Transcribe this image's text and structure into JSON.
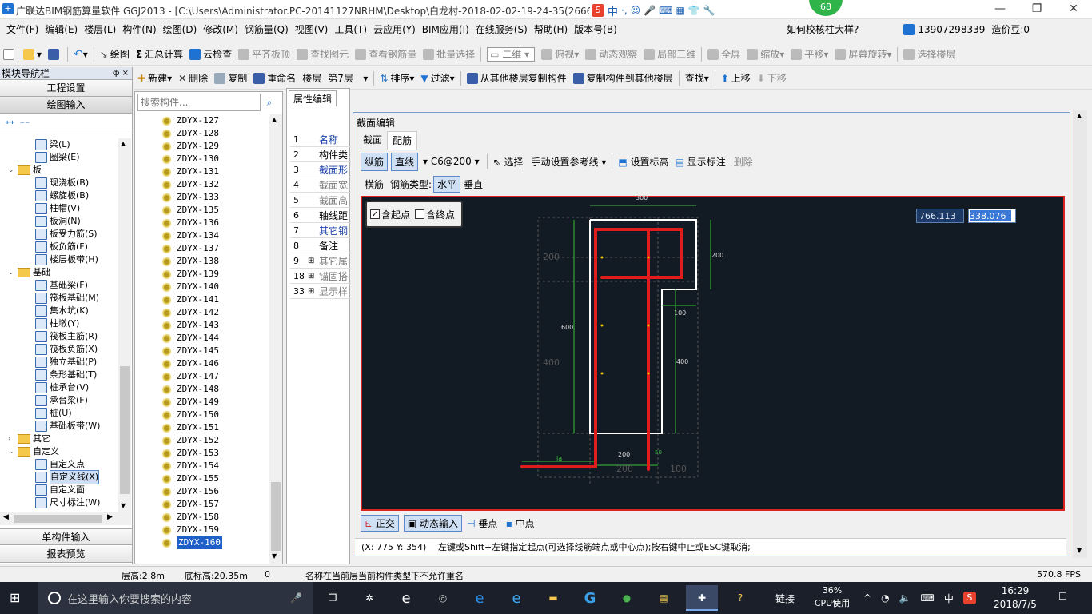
{
  "title": "广联达BIM钢筋算量软件 GGJ2013 - [C:\\Users\\Administrator.PC-20141127NRHM\\Desktop\\白龙村-2018-02-02-19-24-35(2666版).GGJ12]",
  "badge": "68",
  "menu": [
    "文件(F)",
    "编辑(E)",
    "楼层(L)",
    "构件(N)",
    "绘图(D)",
    "修改(M)",
    "钢筋量(Q)",
    "视图(V)",
    "工具(T)",
    "云应用(Y)",
    "BIM应用(I)",
    "在线服务(S)",
    "帮助(H)",
    "版本号(B)"
  ],
  "menu_right": {
    "help_q": "如何校核柱大样?",
    "user": "13907298339",
    "price": "造价豆:0"
  },
  "toolbar1": {
    "draw": "绘图",
    "sum": "汇总计算",
    "cloud": "云检查",
    "flat": "平齐板顶",
    "find": "查找图元",
    "viewq": "查看钢筋量",
    "batch": "批量选择",
    "view2d": "二维",
    "top": "俯视",
    "dyn": "动态观察",
    "local3d": "局部三维",
    "full": "全屏",
    "zoom": "缩放",
    "pan": "平移",
    "rotate": "屏幕旋转",
    "selfloor": "选择楼层"
  },
  "toolbar2": {
    "new": "新建",
    "del": "删除",
    "copy": "复制",
    "rename": "重命名",
    "floor": "楼层",
    "floorval": "第7层",
    "sort": "排序",
    "filter": "过滤",
    "copyfrom": "从其他楼层复制构件",
    "copyto": "复制构件到其他楼层",
    "find": "查找",
    "up": "上移",
    "down": "下移"
  },
  "nav": {
    "header": "模块导航栏",
    "pin": "ф ×",
    "proj": "工程设置",
    "draw": "绘图输入",
    "single": "单构件输入",
    "report": "报表预览"
  },
  "tree": [
    {
      "t": "梁(L)",
      "lvl": 2
    },
    {
      "t": "圈梁(E)",
      "lvl": 2
    },
    {
      "t": "板",
      "lvl": 0,
      "folder": true,
      "exp": "⌄"
    },
    {
      "t": "现浇板(B)",
      "lvl": 2
    },
    {
      "t": "螺旋板(B)",
      "lvl": 2
    },
    {
      "t": "柱帽(V)",
      "lvl": 2
    },
    {
      "t": "板洞(N)",
      "lvl": 2
    },
    {
      "t": "板受力筋(S)",
      "lvl": 2
    },
    {
      "t": "板负筋(F)",
      "lvl": 2
    },
    {
      "t": "楼层板带(H)",
      "lvl": 2
    },
    {
      "t": "基础",
      "lvl": 0,
      "folder": true,
      "exp": "⌄"
    },
    {
      "t": "基础梁(F)",
      "lvl": 2
    },
    {
      "t": "筏板基础(M)",
      "lvl": 2
    },
    {
      "t": "集水坑(K)",
      "lvl": 2
    },
    {
      "t": "柱墩(Y)",
      "lvl": 2
    },
    {
      "t": "筏板主筋(R)",
      "lvl": 2
    },
    {
      "t": "筏板负筋(X)",
      "lvl": 2
    },
    {
      "t": "独立基础(P)",
      "lvl": 2
    },
    {
      "t": "条形基础(T)",
      "lvl": 2
    },
    {
      "t": "桩承台(V)",
      "lvl": 2
    },
    {
      "t": "承台梁(F)",
      "lvl": 2
    },
    {
      "t": "桩(U)",
      "lvl": 2
    },
    {
      "t": "基础板带(W)",
      "lvl": 2
    },
    {
      "t": "其它",
      "lvl": 0,
      "folder": true,
      "exp": "›"
    },
    {
      "t": "自定义",
      "lvl": 0,
      "folder": true,
      "exp": "⌄"
    },
    {
      "t": "自定义点",
      "lvl": 2
    },
    {
      "t": "自定义线(X)",
      "lvl": 2,
      "sel": true
    },
    {
      "t": "自定义面",
      "lvl": 2
    },
    {
      "t": "尺寸标注(W)",
      "lvl": 2
    }
  ],
  "search_placeholder": "搜索构件...",
  "components": [
    "ZDYX-127",
    "ZDYX-128",
    "ZDYX-129",
    "ZDYX-130",
    "ZDYX-131",
    "ZDYX-132",
    "ZDYX-133",
    "ZDYX-135",
    "ZDYX-136",
    "ZDYX-134",
    "ZDYX-137",
    "ZDYX-138",
    "ZDYX-139",
    "ZDYX-140",
    "ZDYX-141",
    "ZDYX-142",
    "ZDYX-143",
    "ZDYX-144",
    "ZDYX-145",
    "ZDYX-146",
    "ZDYX-147",
    "ZDYX-148",
    "ZDYX-149",
    "ZDYX-150",
    "ZDYX-151",
    "ZDYX-152",
    "ZDYX-153",
    "ZDYX-154",
    "ZDYX-155",
    "ZDYX-156",
    "ZDYX-157",
    "ZDYX-158",
    "ZDYX-159",
    "ZDYX-160"
  ],
  "props": {
    "tab": "属性编辑",
    "rows": [
      {
        "n": "1",
        "v": "名称"
      },
      {
        "n": "2",
        "v": "构件类"
      },
      {
        "n": "3",
        "v": "截面形"
      },
      {
        "n": "4",
        "v": "截面宽"
      },
      {
        "n": "5",
        "v": "截面高"
      },
      {
        "n": "6",
        "v": "轴线距"
      },
      {
        "n": "7",
        "v": "其它钢"
      },
      {
        "n": "8",
        "v": "备注"
      },
      {
        "n": "9",
        "v": "其它属"
      },
      {
        "n": "18",
        "v": "锚固搭"
      },
      {
        "n": "33",
        "v": "显示样"
      }
    ]
  },
  "dialog": {
    "title": "截面编辑",
    "tabs": [
      "截面",
      "配筋"
    ],
    "t1": {
      "long": "纵筋",
      "line": "直线",
      "spec": "C6@200",
      "select": "选择",
      "manual": "手动设置参考线",
      "setelev": "设置标高",
      "showmark": "显示标注",
      "delete": "删除"
    },
    "t2": {
      "hbar": "横筋",
      "type": "钢筋类型:",
      "horiz": "水平",
      "vert": "垂直"
    },
    "chk": {
      "start": "含起点",
      "end": "含终点"
    },
    "coord": {
      "x": "766.113",
      "y": "338.076"
    },
    "dims": {
      "d300": "300",
      "d200r": "200",
      "d200l": "200",
      "d600": "600",
      "d400l": "400",
      "d400r": "400",
      "d100": "100",
      "d200b": "200",
      "d200bb": "200",
      "d100b": "100",
      "la": "la",
      "d50": "50"
    },
    "bottom": {
      "ortho": "正交",
      "dyn": "动态输入",
      "perp": "垂点",
      "mid": "中点"
    },
    "statusline": "(X: 775 Y: 354)",
    "hint": "左键或Shift+左键指定起点(可选择线筋端点或中心点);按右键中止或ESC键取消;"
  },
  "status": {
    "floorh": "层高:2.8m",
    "bottom": "底标高:20.35m",
    "zero": "0",
    "msg": "名称在当前层当前构件类型下不允许重名",
    "fps": "570.8 FPS"
  },
  "taskbar": {
    "search": "在这里输入你要搜索的内容",
    "link": "链接",
    "cpu": "36%",
    "cpuname": "CPU使用",
    "ime": "中",
    "time": "16:29",
    "date": "2018/7/5"
  },
  "colors": {
    "accent": "#1e73d2",
    "rebar": "#e01c1c",
    "canvas": "#121a24",
    "dim": "#39c239"
  }
}
